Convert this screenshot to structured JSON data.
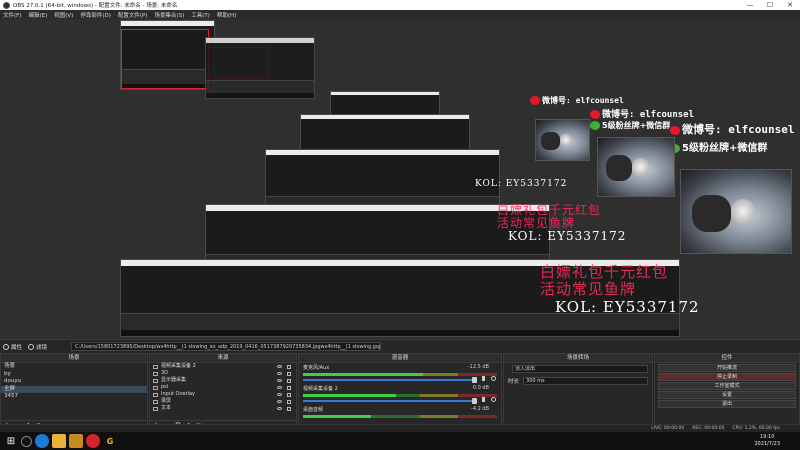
{
  "window": {
    "title": "OBS 27.0.1 (64-bit, windows) - 配置文件: 未命名 - 场景: 未命名",
    "controls": [
      "—",
      "☐",
      "✕"
    ]
  },
  "menu": [
    "文件(F)",
    "编辑(E)",
    "视图(V)",
    "停靠部件(D)",
    "配置文件(P)",
    "场景集合(S)",
    "工具(T)",
    "帮助(H)"
  ],
  "overlay": {
    "weibo_handle": "微博号: elfcounsel",
    "fans_line": "5级粉丝牌+微信群",
    "promo_line1": "白嫖礼包千元红包",
    "promo_line2": "活动常见鱼牌",
    "kol_code": "KOL: EY5337172"
  },
  "controls_bar": {
    "properties": "属性",
    "filters": "滤镜",
    "path": "C:/Users/15801723895/Desktop/ws4http__(1 slowing_so_adp_2019_0416_0517387920735834.jpgws4http__(1 slowing.jpg"
  },
  "scenes": {
    "title": "场景",
    "items": [
      "场景",
      "by",
      "douyu",
      "全屏",
      "3457"
    ]
  },
  "sources": {
    "title": "来源",
    "items": [
      "视频采集设备 2",
      "3D",
      "显示器采集",
      "psl",
      "Input Overlay",
      "录屏",
      "文本"
    ]
  },
  "mixer": {
    "title": "混音器",
    "channels": [
      {
        "name": "麦克风/Aux",
        "db": "-12.5 dB",
        "level": 0.62
      },
      {
        "name": "视频采集设备 2",
        "db": "0.0 dB",
        "level": 0.48
      },
      {
        "name": "桌面音频",
        "db": "-4.2 dB",
        "level": 0.35
      }
    ]
  },
  "transitions": {
    "title": "场景转场",
    "fade": "淡入淡出",
    "duration_label": "时长",
    "duration_value": "300 ms"
  },
  "controls": {
    "title": "控件",
    "buttons": [
      "开始推流",
      "停止录制",
      "工作室模式",
      "设置",
      "退出"
    ]
  },
  "status": {
    "live": "LIVE: 00:00:00",
    "rec": "REC: 00:00:00",
    "cpu": "CPU: 1.2%, 60.00 fps"
  },
  "taskbar": {
    "time": "19:10",
    "date": "2021/7/23"
  },
  "colors": {
    "promo_red": "#ff2a5a",
    "selection_box": "#e0202a",
    "weibo_red": "#e6162d",
    "wechat_green": "#3cb034"
  }
}
